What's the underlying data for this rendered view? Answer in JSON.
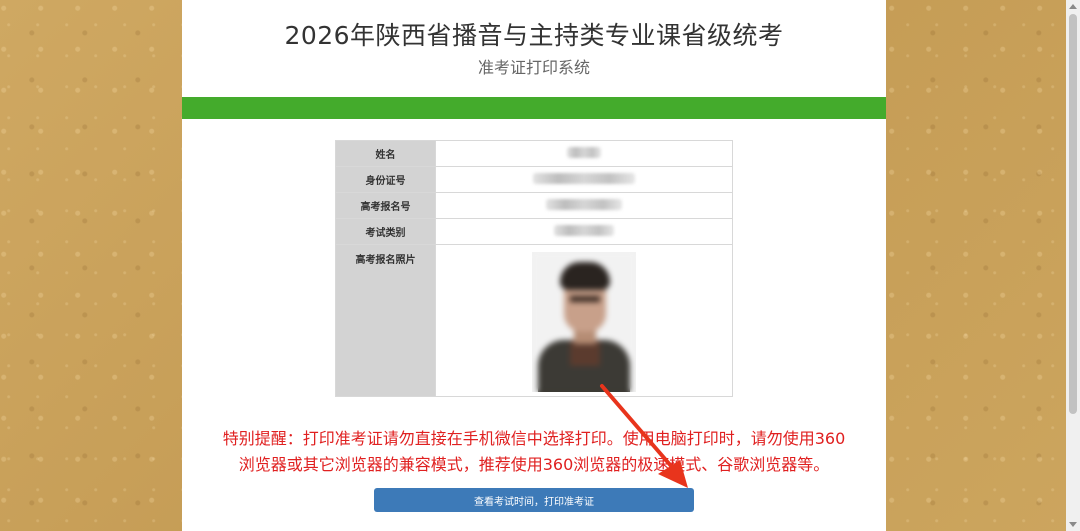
{
  "header": {
    "title": "2026年陕西省播音与主持类专业课省级统考",
    "subtitle": "准考证打印系统"
  },
  "info": {
    "rows": [
      {
        "label": "姓名"
      },
      {
        "label": "身份证号"
      },
      {
        "label": "高考报名号"
      },
      {
        "label": "考试类别"
      },
      {
        "label": "高考报名照片"
      }
    ]
  },
  "notice": {
    "line1": "特别提醒：打印准考证请勿直接在手机微信中选择打印。使用电脑打印时，请勿使用360",
    "line2": "浏览器或其它浏览器的兼容模式，推荐使用360浏览器的极速模式、谷歌浏览器等。"
  },
  "actions": {
    "print_label": "查看考试时间，打印准考证"
  },
  "colors": {
    "accent_bar": "#44ab2c",
    "button": "#3d7ab8",
    "notice": "#e02020",
    "background": "#c9a35c"
  }
}
